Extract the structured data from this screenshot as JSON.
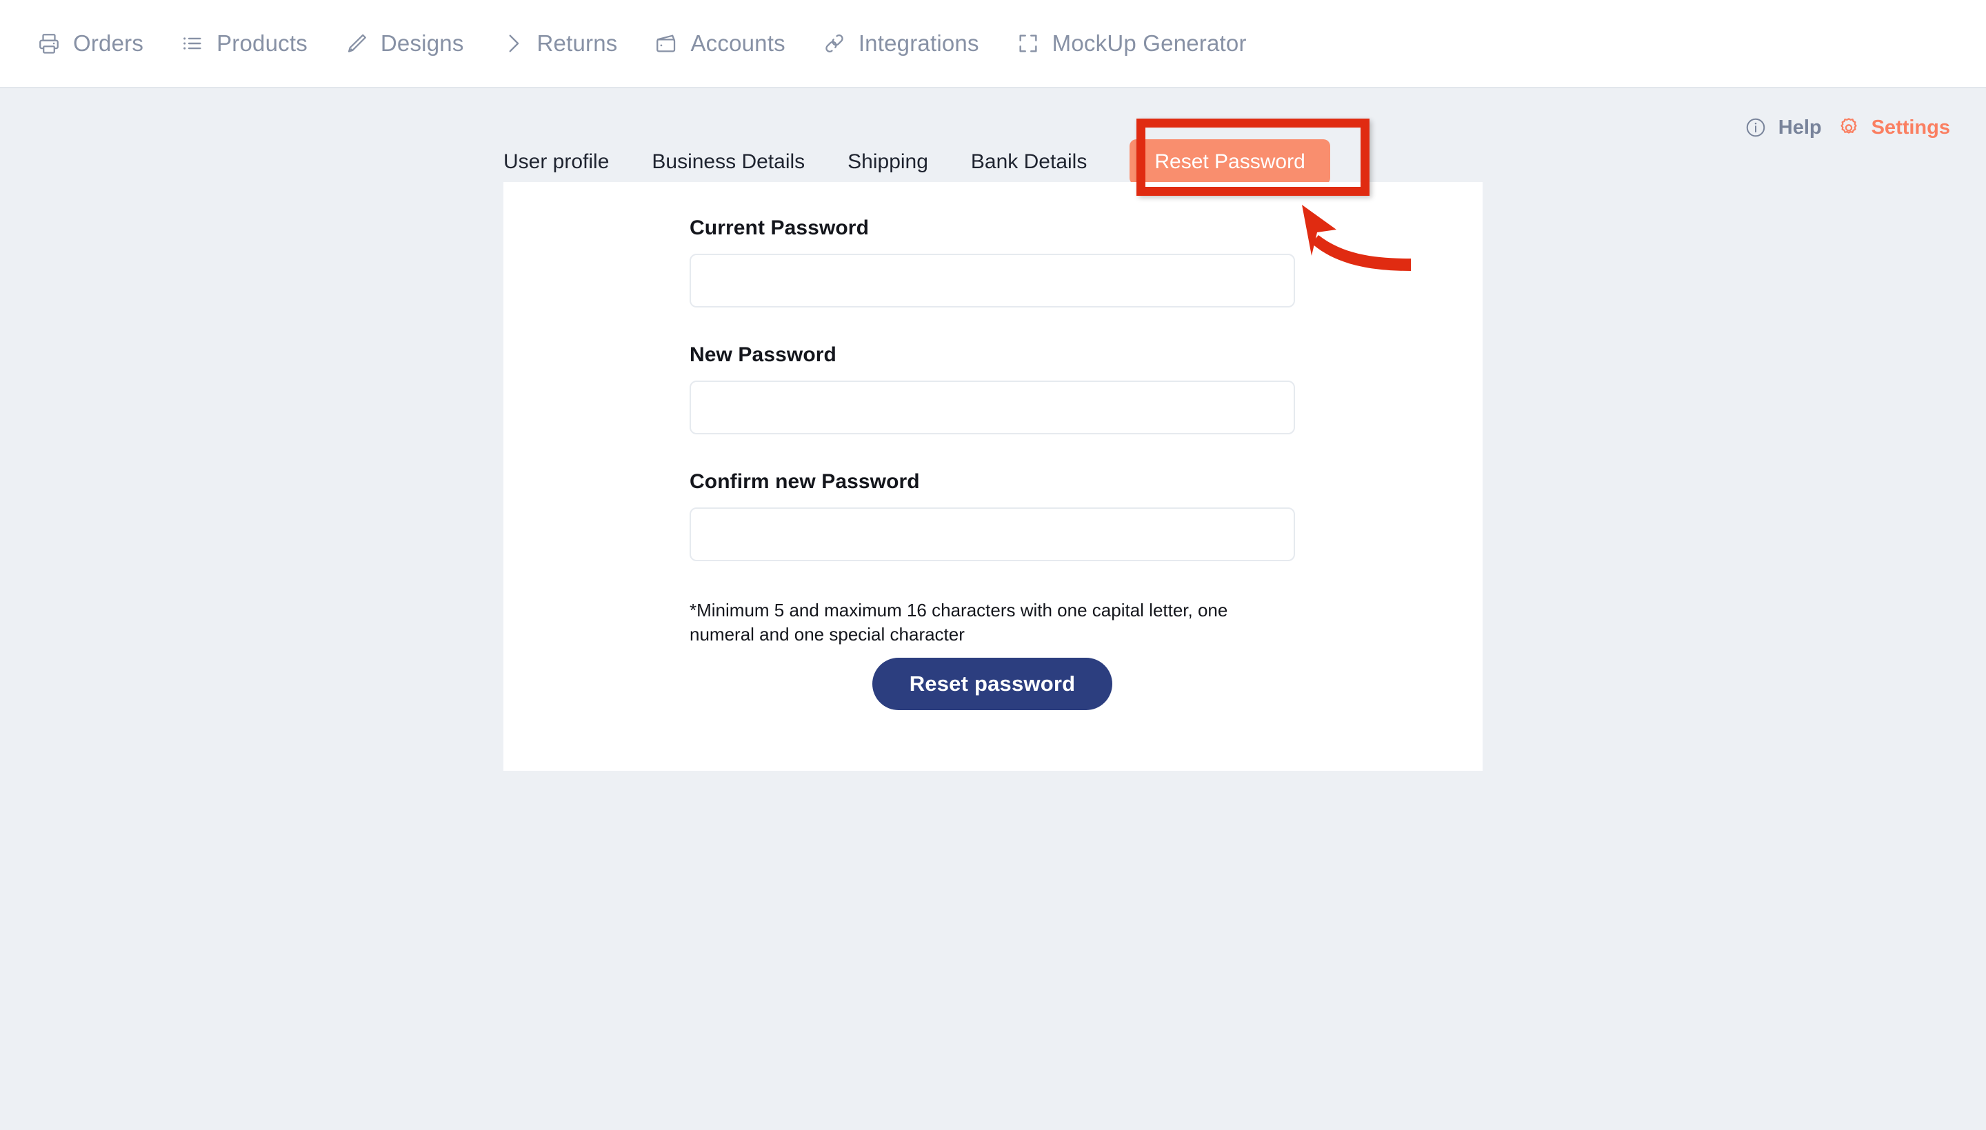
{
  "nav": {
    "items": [
      {
        "label": "Orders",
        "icon": "printer-icon"
      },
      {
        "label": "Products",
        "icon": "list-icon"
      },
      {
        "label": "Designs",
        "icon": "pencil-icon"
      },
      {
        "label": "Returns",
        "icon": "chevron-right-icon"
      },
      {
        "label": "Accounts",
        "icon": "wallet-icon"
      },
      {
        "label": "Integrations",
        "icon": "link-icon"
      },
      {
        "label": "MockUp Generator",
        "icon": "crop-frame-icon"
      }
    ]
  },
  "utility": {
    "help": {
      "label": "Help",
      "icon": "info-circle-icon"
    },
    "settings": {
      "label": "Settings",
      "icon": "gear-icon",
      "color": "#fa7f61"
    }
  },
  "tabs": [
    {
      "label": "User profile",
      "active": false
    },
    {
      "label": "Business Details",
      "active": false
    },
    {
      "label": "Shipping",
      "active": false
    },
    {
      "label": "Bank Details",
      "active": false
    },
    {
      "label": "Reset Password",
      "active": true
    }
  ],
  "form": {
    "fields": [
      {
        "label": "Current Password",
        "value": "",
        "placeholder": ""
      },
      {
        "label": "New Password",
        "value": "",
        "placeholder": ""
      },
      {
        "label": "Confirm new Password",
        "value": "",
        "placeholder": ""
      }
    ],
    "hint": "*Minimum 5 and maximum 16 characters with one capital letter, one numeral and one special character",
    "submit_label": "Reset password"
  },
  "colors": {
    "page_background": "#edf0f4",
    "card_background": "#ffffff",
    "nav_text": "#8791a5",
    "accent_orange": "#fa7f61",
    "active_tab_pill": "#f98e6e",
    "primary_button": "#2c3e7f",
    "annotation_red": "#e02b11"
  },
  "annotation": {
    "highlight_target": "Reset Password",
    "shape": "red-rectangle-with-curved-arrow"
  }
}
